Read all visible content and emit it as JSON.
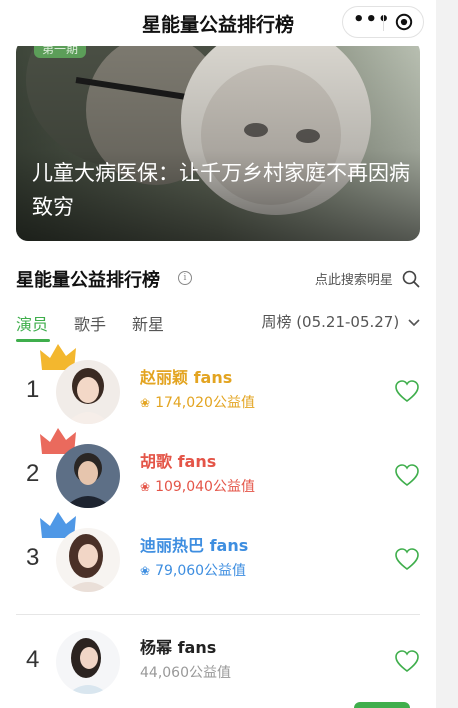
{
  "topbar": {
    "title": "星能量公益排行榜",
    "more_icon": "more-dots-icon",
    "close_icon": "target-close-icon"
  },
  "banner": {
    "issue_tag": "第一期",
    "headline": "儿童大病医保：让千万乡村家庭不再因病致穷"
  },
  "rank_header": {
    "title": "星能量公益排行榜",
    "info_glyph": "i",
    "search_label": "点此搜索明星"
  },
  "tabs": [
    {
      "label": "演员",
      "active": true
    },
    {
      "label": "歌手",
      "active": false
    },
    {
      "label": "新星",
      "active": false
    }
  ],
  "period": {
    "label": "周榜 (05.21-05.27)"
  },
  "ranking": [
    {
      "rank": "1",
      "name": "赵丽颖 fans",
      "score": "174,020公益值",
      "color": "#e3a421"
    },
    {
      "rank": "2",
      "name": "胡歌 fans",
      "score": "109,040公益值",
      "color": "#e45548"
    },
    {
      "rank": "3",
      "name": "迪丽热巴 fans",
      "score": "79,060公益值",
      "color": "#3e8ee0"
    },
    {
      "rank": "4",
      "name": "杨幂 fans",
      "score": "44,060公益值",
      "color": "#999999"
    }
  ],
  "accent_color": "#3fae4c"
}
